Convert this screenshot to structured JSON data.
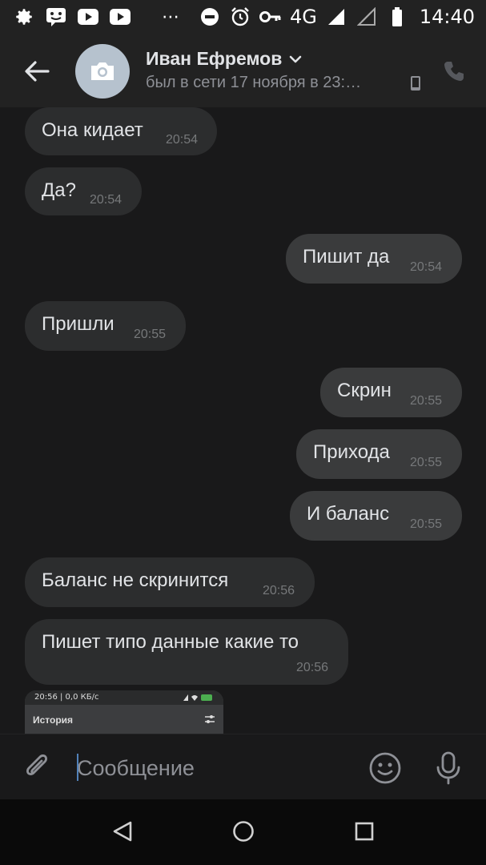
{
  "status_bar": {
    "network": "4G",
    "time": "14:40",
    "more": "⋯"
  },
  "header": {
    "contact_name": "Иван Ефремов",
    "contact_status": "был в сети 17 ноября в 23:…",
    "avatar_icon": "camera-icon",
    "back_icon": "arrow-left-icon",
    "call_icon": "phone-icon"
  },
  "messages": [
    {
      "text": "Она кидает",
      "time": "20:54",
      "direction": "in"
    },
    {
      "text": "Да?",
      "time": "20:54",
      "direction": "in"
    },
    {
      "text": "Пишит да",
      "time": "20:54",
      "direction": "out"
    },
    {
      "text": "Пришли",
      "time": "20:55",
      "direction": "in"
    },
    {
      "text": "Скрин",
      "time": "20:55",
      "direction": "out"
    },
    {
      "text": "Прихода",
      "time": "20:55",
      "direction": "out"
    },
    {
      "text": "И баланс",
      "time": "20:55",
      "direction": "out"
    },
    {
      "text": "Баланс не скринится",
      "time": "20:56",
      "direction": "in"
    },
    {
      "text": "Пишет типо данные какие то",
      "time": "20:56",
      "direction": "in"
    }
  ],
  "image_preview": {
    "status_text": "20:56 | 0,0 КБ/с",
    "title": "История"
  },
  "composer": {
    "placeholder": "Сообщение",
    "value": ""
  },
  "colors": {
    "background": "#19191a",
    "bar": "#222222",
    "bubble_in": "#2c2d2e",
    "bubble_out": "#3a3b3c",
    "text": "#e1e3e6",
    "muted": "#76787a",
    "accent": "#5181b8"
  }
}
